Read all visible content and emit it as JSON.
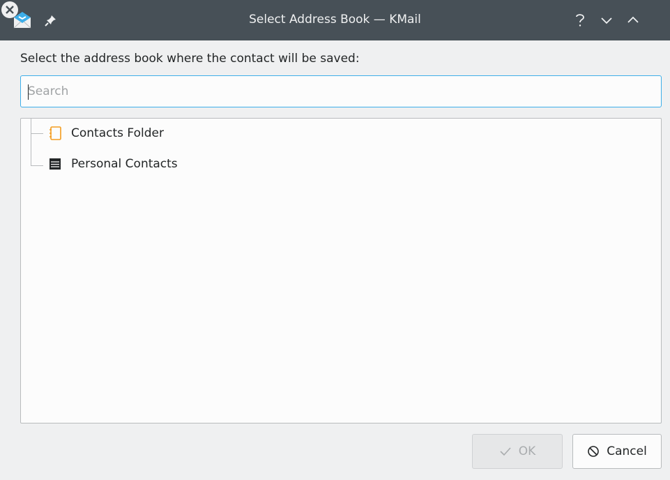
{
  "window": {
    "title": "Select Address Book — KMail"
  },
  "dialog": {
    "prompt": "Select the address book where the contact will be saved:",
    "search": {
      "placeholder": "Search",
      "value": ""
    }
  },
  "tree": {
    "items": [
      {
        "label": "Contacts Folder",
        "icon": "address-book-icon"
      },
      {
        "label": "Personal Contacts",
        "icon": "contacts-list-icon"
      }
    ]
  },
  "buttons": {
    "ok_label": "OK",
    "cancel_label": "Cancel"
  },
  "colors": {
    "titlebar": "#475057",
    "accent": "#3daee9",
    "folder_icon": "#f39c1f"
  }
}
